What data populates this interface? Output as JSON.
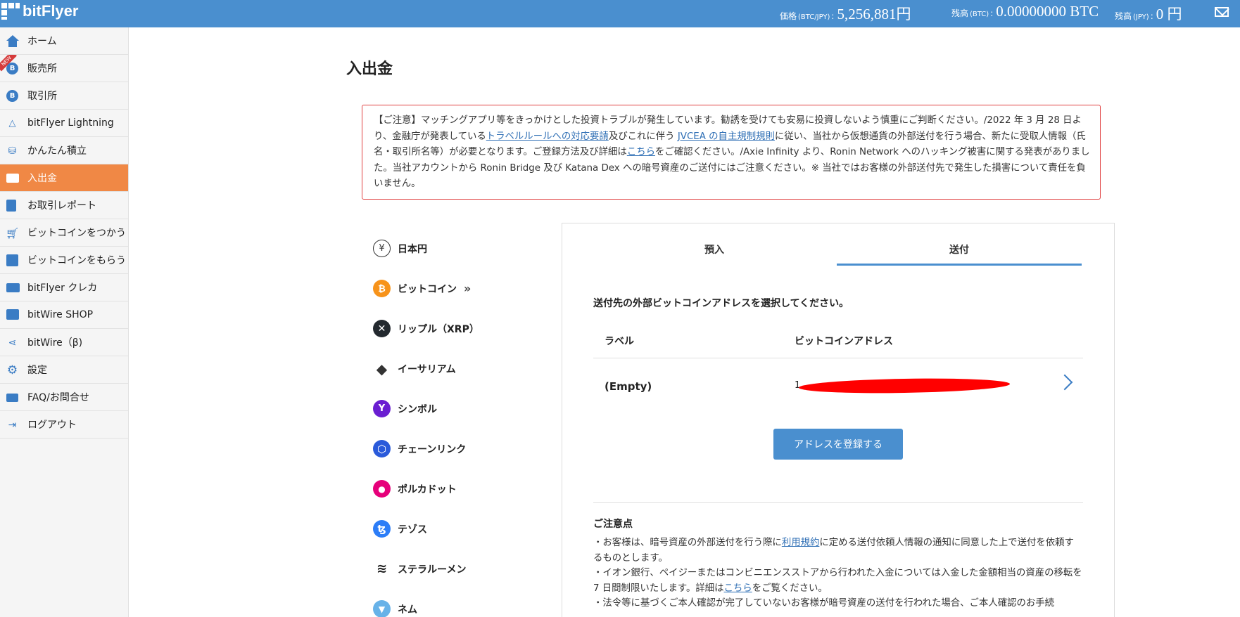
{
  "header": {
    "brand": "bitFlyer",
    "price_label": "価格",
    "price_sub": "(BTC/JPY)",
    "price_value": "5,256,881円",
    "btc_label": "残高",
    "btc_sub": "(BTC)",
    "btc_value": "0.00000000 BTC",
    "jpy_label": "残高",
    "jpy_sub": "(JPY)",
    "jpy_value": "0 円",
    "brand_color": "#4a8fcf"
  },
  "sidebar": {
    "new_badge": "NEW",
    "items": [
      {
        "label": "ホーム",
        "icon": "home-icon"
      },
      {
        "label": "販売所",
        "icon": "bitcoin-icon"
      },
      {
        "label": "取引所",
        "icon": "bitcoin-icon"
      },
      {
        "label": "bitFlyer Lightning",
        "icon": "lightning-icon"
      },
      {
        "label": "かんたん積立",
        "icon": "coins-icon"
      },
      {
        "label": "入出金",
        "icon": "wallet-icon",
        "active": true
      },
      {
        "label": "お取引レポート",
        "icon": "report-icon"
      },
      {
        "label": "ビットコインをつかう",
        "icon": "cart-icon"
      },
      {
        "label": "ビットコインをもらう",
        "icon": "gift-icon"
      },
      {
        "label": "bitFlyer クレカ",
        "icon": "card-icon"
      },
      {
        "label": "bitWire SHOP",
        "icon": "shop-icon"
      },
      {
        "label": "bitWire（β)",
        "icon": "share-icon"
      },
      {
        "label": "設定",
        "icon": "gear-icon"
      },
      {
        "label": "FAQ/お問合せ",
        "icon": "mail-icon"
      },
      {
        "label": "ログアウト",
        "icon": "logout-icon"
      }
    ],
    "active_color": "#f08845"
  },
  "main": {
    "title": "入出金",
    "notice": {
      "t1": "【ご注意】マッチングアプリ等をきっかけとした投資トラブルが発生しています。勧誘を受けても安易に投資しないよう慎重にご判断ください。/2022 年 3 月 28 日より、金融庁が発表している",
      "link1": "トラベルルールへの対応要請",
      "t2": "及びこれに伴う ",
      "link2": "JVCEA の自主規制規則",
      "t3": "に従い、当社から仮想通貨の外部送付を行う場合、新たに受取人情報（氏名・取引所名等）が必要となります。ご登録方法及び詳細は",
      "link3": "こちら",
      "t4": "をご確認ください。/Axie Infinity より、Ronin Network へのハッキング被害に関する発表がありました。当社アカウントから Ronin Bridge 及び Katana Dex への暗号資産のご送付にはご注意ください。※ 当社ではお客様の外部送付先で発生した損害について責任を負いません。"
    },
    "currencies": [
      {
        "name": "日本円",
        "icon": "yen-icon",
        "symbol": "¥",
        "color": "#ffffff"
      },
      {
        "name": "ビットコイン",
        "icon": "bitcoin-icon",
        "symbol": "₿",
        "color": "#f7931a",
        "chevron": "»"
      },
      {
        "name": "リップル（XRP）",
        "icon": "xrp-icon",
        "symbol": "✕",
        "color": "#23292f"
      },
      {
        "name": "イーサリアム",
        "icon": "ethereum-icon",
        "symbol": "◆",
        "color": "#ffffff"
      },
      {
        "name": "シンボル",
        "icon": "symbol-icon",
        "symbol": "Y",
        "color": "#6a1ed1"
      },
      {
        "name": "チェーンリンク",
        "icon": "chainlink-icon",
        "symbol": "⬡",
        "color": "#2a5ada"
      },
      {
        "name": "ポルカドット",
        "icon": "polkadot-icon",
        "symbol": "●",
        "color": "#e6007a"
      },
      {
        "name": "テゾス",
        "icon": "tezos-icon",
        "symbol": "ꜩ",
        "color": "#2c7df7"
      },
      {
        "name": "ステラルーメン",
        "icon": "stellar-icon",
        "symbol": "≋",
        "color": "#ffffff"
      },
      {
        "name": "ネム",
        "icon": "nem-icon",
        "symbol": "▼",
        "color": "#67b2e8"
      }
    ],
    "panel": {
      "tabs": [
        {
          "label": "預入",
          "active": false
        },
        {
          "label": "送付",
          "active": true
        }
      ],
      "instruction": "送付先の外部ビットコインアドレスを選択してください。",
      "col_label": "ラベル",
      "col_address": "ビットコインアドレス",
      "row_label": "(Empty)",
      "row_address": "1",
      "register_button": "アドレスを登録する",
      "notes_title": "ご注意点",
      "n1a": "・お客様は、暗号資産の外部送付を行う際に",
      "n1link": "利用規約",
      "n1b": "に定める送付依頼人情報の通知に同意した上で送付を依頼するものとします。",
      "n2a": "・イオン銀行、ペイジーまたはコンビニエンスストアから行われた入金については入金した金額相当の資産の移転を 7 日間制限いたします。詳細は",
      "n2link": "こちら",
      "n2b": "をご覧ください。",
      "n3": "・法令等に基づくご本人確認が完了していないお客様が暗号資産の送付を行われた場合、ご本人確認のお手続"
    }
  }
}
